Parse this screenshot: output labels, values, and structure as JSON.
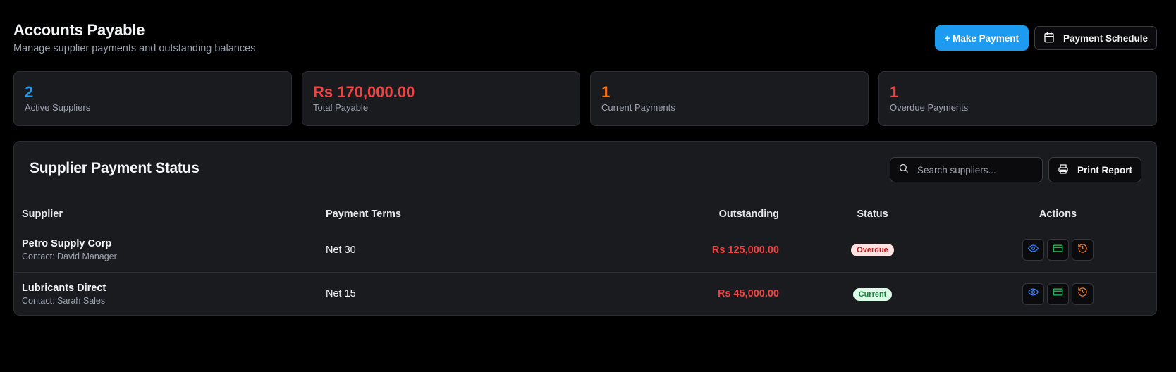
{
  "header": {
    "title": "Accounts Payable",
    "subtitle": "Manage supplier payments and outstanding balances",
    "make_payment_label": "+ Make Payment",
    "schedule_label": "Payment Schedule"
  },
  "stats": [
    {
      "value": "2",
      "label": "Active Suppliers",
      "color": "#1d9bf0"
    },
    {
      "value": "Rs 170,000.00",
      "label": "Total Payable",
      "color": "#ef4444"
    },
    {
      "value": "1",
      "label": "Current Payments",
      "color": "#f97316"
    },
    {
      "value": "1",
      "label": "Overdue Payments",
      "color": "#ef4444"
    }
  ],
  "panel": {
    "title": "Supplier Payment Status",
    "search_placeholder": "Search suppliers...",
    "print_label": "Print Report",
    "columns": {
      "supplier": "Supplier",
      "terms": "Payment Terms",
      "outstanding": "Outstanding",
      "status": "Status",
      "actions": "Actions"
    },
    "rows": [
      {
        "name": "Petro Supply Corp",
        "contact": "Contact: David Manager",
        "terms": "Net 30",
        "outstanding": "Rs 125,000.00",
        "status": "Overdue"
      },
      {
        "name": "Lubricants Direct",
        "contact": "Contact: Sarah Sales",
        "terms": "Net 15",
        "outstanding": "Rs 45,000.00",
        "status": "Current"
      }
    ],
    "action_icons": [
      "eye-icon",
      "credit-card-icon",
      "history-icon"
    ]
  },
  "colors": {
    "accent": "#1d9bf0",
    "danger": "#ef4444",
    "warning": "#f97316",
    "view_icon": "#3b82f6",
    "pay_icon": "#22c55e",
    "history_icon": "#f97316"
  }
}
